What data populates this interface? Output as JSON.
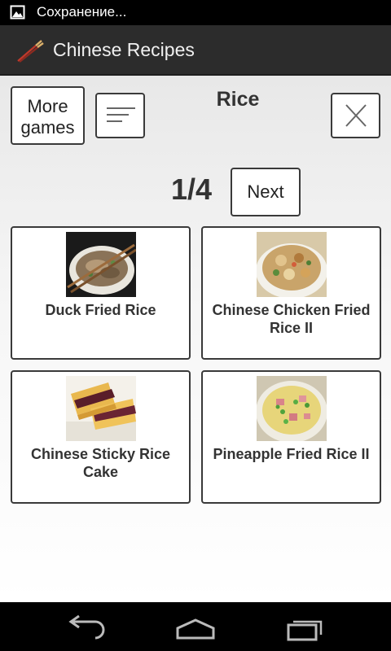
{
  "status_bar": {
    "text": "Сохранение...",
    "icon": "image-icon"
  },
  "action_bar": {
    "title": "Chinese Recipes",
    "icon": "chopsticks-icon"
  },
  "toolbar": {
    "more_games_line1": "More",
    "more_games_line2": "games",
    "sort_icon": "sort-lines-icon",
    "close_icon": "close-x-icon"
  },
  "category": {
    "title": "Rice"
  },
  "pagination": {
    "indicator": "1/4",
    "next_label": "Next"
  },
  "recipes": [
    {
      "title": "Duck Fried Rice",
      "image": "noodle-bowl-with-chopsticks"
    },
    {
      "title": "Chinese Chicken Fried Rice II",
      "image": "chicken-fried-rice-plate"
    },
    {
      "title": "Chinese Sticky Rice Cake",
      "image": "sticky-rice-cake-slices"
    },
    {
      "title": "Pineapple Fried Rice II",
      "image": "pineapple-fried-rice-plate"
    }
  ],
  "nav_bar": {
    "back_icon": "back-icon",
    "home_icon": "home-icon",
    "recents_icon": "recents-icon"
  }
}
